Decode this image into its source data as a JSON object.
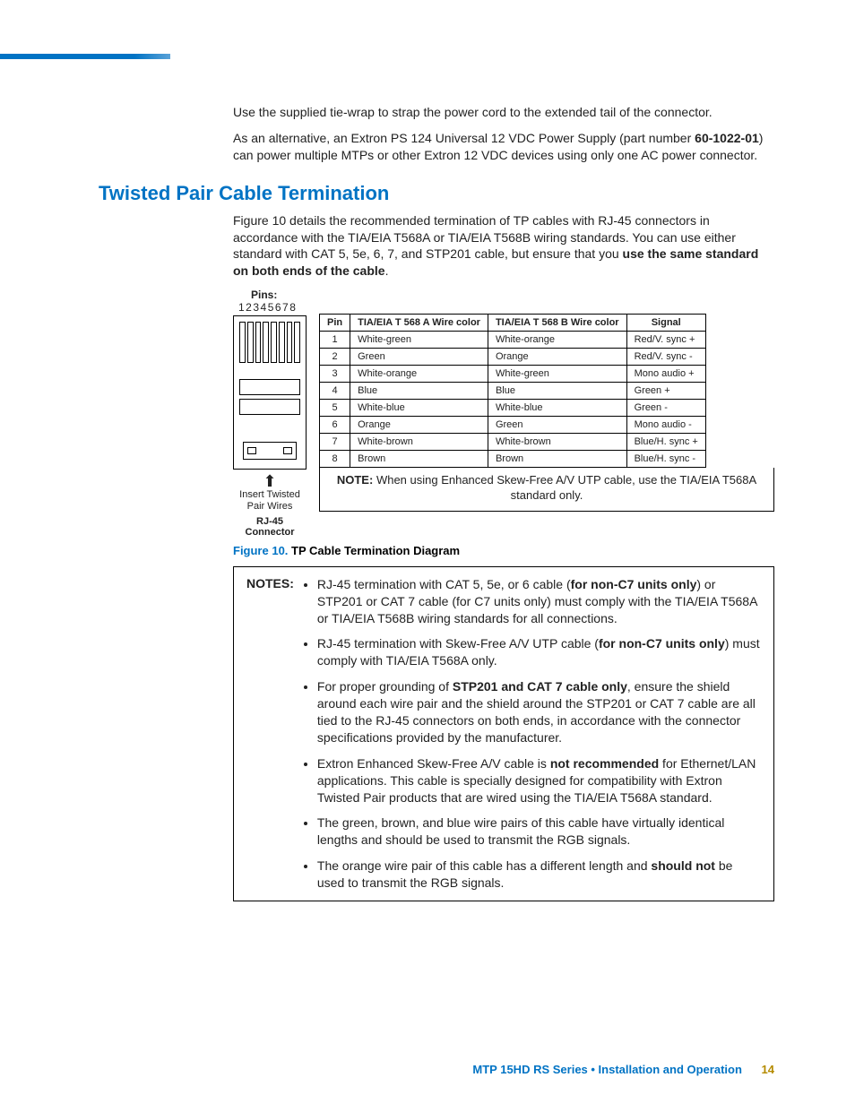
{
  "intro": {
    "p1": "Use the supplied tie-wrap to strap the power cord to the extended tail of the connector.",
    "p2a": "As an alternative, an Extron PS 124 Universal 12 VDC Power Supply (part number ",
    "p2_part": "60-1022-01",
    "p2b": ") can power multiple MTPs or other Extron 12 VDC devices using only one AC power connector."
  },
  "section": {
    "title": "Twisted Pair Cable Termination",
    "p1a": "Figure 10 details the recommended termination of TP cables with RJ-45 connectors in accordance with the TIA/EIA T568A or TIA/EIA T568B wiring standards. You can use either standard with CAT 5, 5e, 6, 7, and STP201 cable, but ensure that you ",
    "p1_bold": "use the same standard on both ends of the cable",
    "p1b": "."
  },
  "figure": {
    "pins_label": "Pins:",
    "pins_nums": "12345678",
    "insert_text": "Insert Twisted Pair Wires",
    "connector_label": "RJ-45 Connector",
    "table": {
      "headers": {
        "pin": "Pin",
        "colA": "TIA/EIA T 568 A Wire color",
        "colB": "TIA/EIA T 568 B Wire color",
        "signal": "Signal"
      },
      "rows": [
        {
          "pin": "1",
          "a": "White-green",
          "b": "White-orange",
          "s": "Red/V. sync +"
        },
        {
          "pin": "2",
          "a": "Green",
          "b": "Orange",
          "s": "Red/V. sync -"
        },
        {
          "pin": "3",
          "a": "White-orange",
          "b": "White-green",
          "s": "Mono audio +"
        },
        {
          "pin": "4",
          "a": "Blue",
          "b": "Blue",
          "s": "Green +"
        },
        {
          "pin": "5",
          "a": "White-blue",
          "b": "White-blue",
          "s": "Green -"
        },
        {
          "pin": "6",
          "a": "Orange",
          "b": "Green",
          "s": "Mono audio -"
        },
        {
          "pin": "7",
          "a": "White-brown",
          "b": "White-brown",
          "s": "Blue/H. sync +"
        },
        {
          "pin": "8",
          "a": "Brown",
          "b": "Brown",
          "s": "Blue/H. sync -"
        }
      ]
    },
    "note_label": "NOTE:",
    "note_text": "When using Enhanced Skew-Free A/V UTP cable, use the TIA/EIA T568A standard only.",
    "caption_lead": "Figure 10. ",
    "caption_rest": "TP Cable Termination Diagram"
  },
  "notes": {
    "label": "NOTES:",
    "items": [
      {
        "pre": "RJ-45 termination with CAT 5, 5e, or 6 cable (",
        "bold": "for non-C7 units only",
        "post": ") or STP201 or CAT 7 cable (for C7 units only) must comply with the TIA/EIA T568A or TIA/EIA T568B wiring standards for all connections."
      },
      {
        "pre": "RJ-45 termination with Skew-Free A/V UTP cable (",
        "bold": "for non-C7 units only",
        "post": ") must comply with TIA/EIA T568A only."
      },
      {
        "pre": "For proper grounding of ",
        "bold": "STP201 and CAT 7 cable only",
        "post": ", ensure the shield around each wire pair and the shield around the STP201 or CAT 7 cable are all tied to the RJ-45 connectors on both ends, in accordance with the connector specifications provided by the manufacturer."
      },
      {
        "pre": "Extron Enhanced Skew-Free A/V cable is ",
        "bold": "not recommended",
        "post": " for Ethernet/LAN applications. This cable is specially designed for compatibility with Extron Twisted Pair products that are wired using the TIA/EIA T568A standard."
      },
      {
        "pre": "The green, brown, and blue wire pairs of this cable have virtually identical lengths and should be used to transmit the RGB signals.",
        "bold": "",
        "post": ""
      },
      {
        "pre": "The orange wire pair of this cable has a different length and ",
        "bold": "should not",
        "post": " be used to transmit the RGB signals."
      }
    ]
  },
  "footer": {
    "text": "MTP 15HD RS Series • Installation and Operation",
    "page": "14"
  }
}
